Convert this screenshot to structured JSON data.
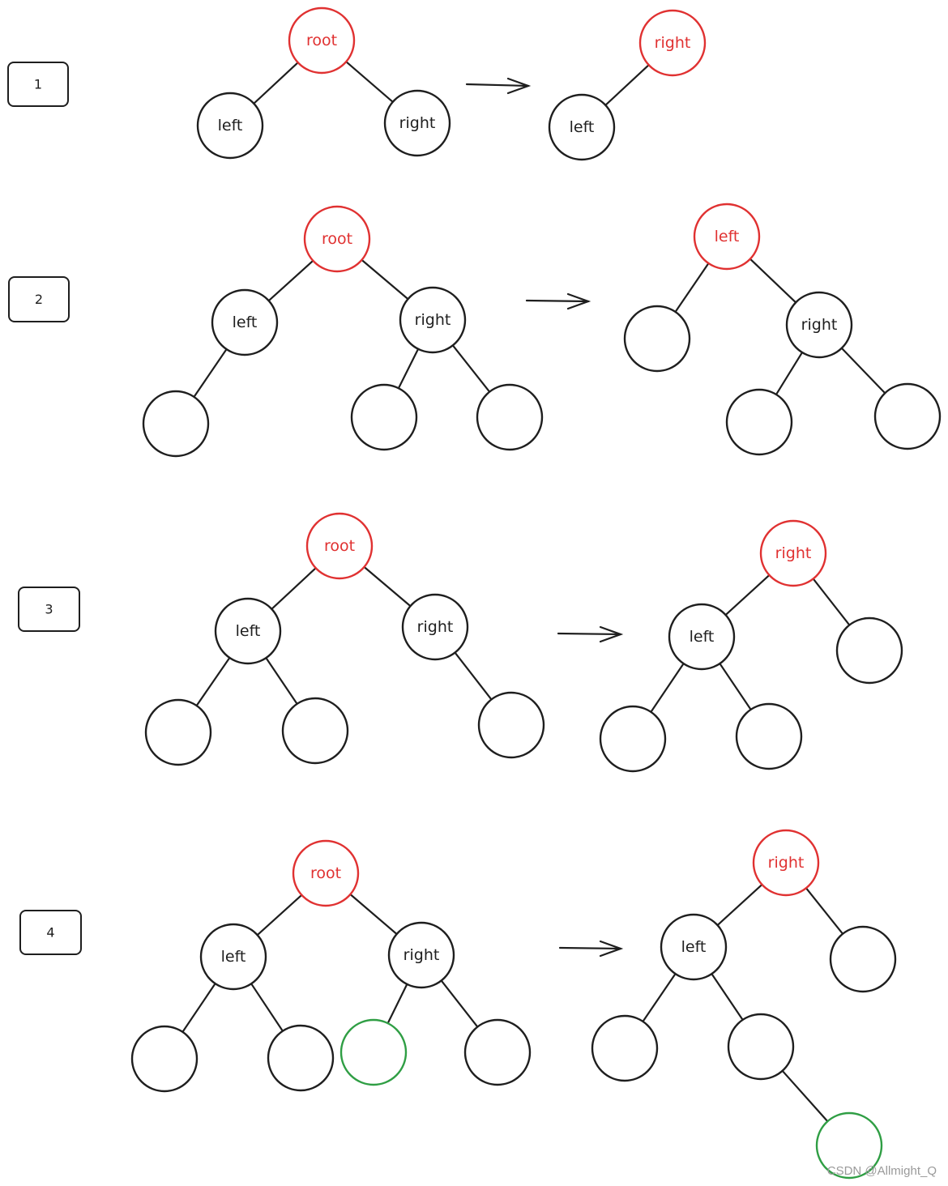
{
  "colors": {
    "stroke": "#1e1e1e",
    "highlight": "#e03131",
    "inserted": "#2f9e44"
  },
  "labels": {
    "root": "root",
    "left": "left",
    "right": "right"
  },
  "steps": [
    {
      "label": "1"
    },
    {
      "label": "2"
    },
    {
      "label": "3"
    },
    {
      "label": "4"
    }
  ],
  "watermark": "CSDN @Allmight_Q"
}
